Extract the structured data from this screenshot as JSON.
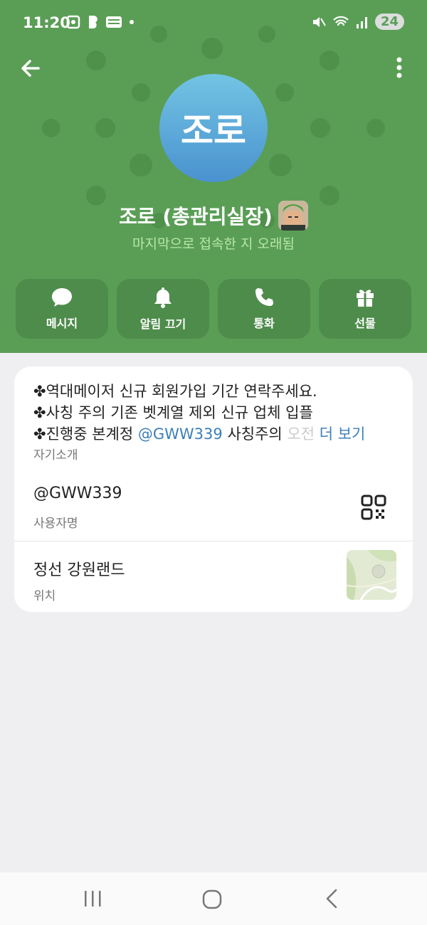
{
  "status_bar": {
    "time": "11:20",
    "battery": "24",
    "left_icons": [
      "screenshot-icon",
      "b-app-icon",
      "webtoon-icon",
      "dot-icon"
    ],
    "right_icons": [
      "mute-icon",
      "wifi-icon",
      "signal-icon"
    ]
  },
  "header": {
    "accent_color": "#5a9e56",
    "avatar_text": "조로",
    "name": "조로 (총관리실장)",
    "last_seen": "마지막으로 접속한 지 오래됨"
  },
  "actions": [
    {
      "label": "메시지",
      "icon": "message-icon"
    },
    {
      "label": "알림 끄기",
      "icon": "bell-icon"
    },
    {
      "label": "통화",
      "icon": "phone-icon"
    },
    {
      "label": "선물",
      "icon": "gift-icon"
    }
  ],
  "bio": {
    "line1": "✤역대메이저 신규 회원가입 기간 연락주세요.",
    "line2": "✤사칭 주의 기존 벳계열 제외 신규 업체 입플",
    "line3_prefix": "✤진행중 본계정 ",
    "line3_mention": "@GWW339",
    "line3_suffix": " 사칭주의 ",
    "line3_fade": "오전",
    "more": "더 보기",
    "caption": "자기소개"
  },
  "username": {
    "value": "@GWW339",
    "caption": "사용자명"
  },
  "location": {
    "value": "정선 강원랜드",
    "caption": "위치"
  }
}
